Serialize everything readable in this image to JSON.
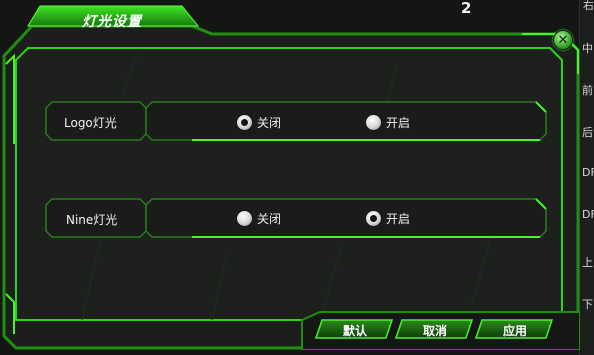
{
  "dialog": {
    "title": "灯光设置",
    "rows": [
      {
        "label": "Logo灯光",
        "options": [
          {
            "label": "关闭",
            "checked": true
          },
          {
            "label": "开启",
            "checked": false
          }
        ]
      },
      {
        "label": "Nine灯光",
        "options": [
          {
            "label": "关闭",
            "checked": false
          },
          {
            "label": "开启",
            "checked": true
          }
        ]
      }
    ],
    "buttons": {
      "default_label": "默认",
      "cancel_label": "取消",
      "apply_label": "应用"
    }
  },
  "background": {
    "top_number": "2",
    "side_chars": [
      "右",
      "中",
      "前",
      "后",
      "DF",
      "DF",
      "上",
      "下"
    ]
  },
  "colors": {
    "frame_green": "#2ed41a",
    "panel_dark": "#1e201e",
    "accent": "#49f22a"
  }
}
